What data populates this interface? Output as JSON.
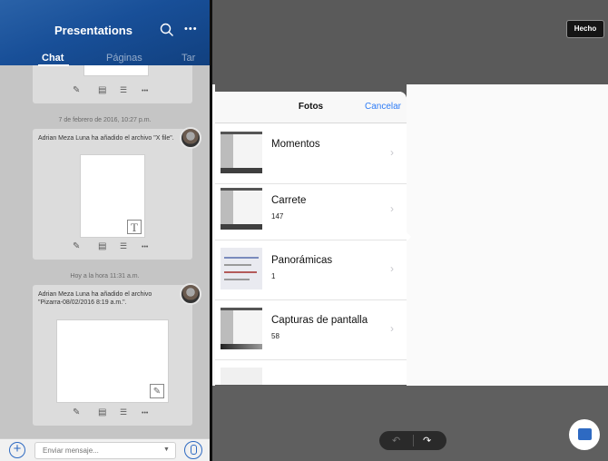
{
  "header": {
    "title": "Presentations",
    "more": "•••",
    "tabs": [
      {
        "label": "Chat",
        "active": true
      },
      {
        "label": "Páginas",
        "active": false
      },
      {
        "label": "Tar",
        "active": false
      }
    ]
  },
  "chat": {
    "messages": [
      {
        "timestamp": "7 de febrero de 2016, 10:27 p.m.",
        "text": "Adrian Meza Luna ha añadido el archivo \"X file\".",
        "thumb_glyph": "T"
      },
      {
        "timestamp": "Hoy a la hora 11:31 a.m.",
        "text": "Adrian Meza Luna ha añadido el archivo \"Pizarra-08/02/2016 8:19 a.m.\".",
        "thumb_glyph": "✎"
      }
    ],
    "actions": [
      "✎",
      "▤",
      "☰",
      "•••"
    ]
  },
  "composer": {
    "placeholder": "Enviar mensaje...",
    "plus": "+",
    "caret": "▼"
  },
  "toolbar": {
    "done_label": "Hecho",
    "undo": "↶",
    "redo": "↷"
  },
  "photos_popover": {
    "title": "Fotos",
    "cancel_label": "Cancelar",
    "albums": [
      {
        "name": "Momentos",
        "count": ""
      },
      {
        "name": "Carrete",
        "count": "147"
      },
      {
        "name": "Panorámicas",
        "count": "1"
      },
      {
        "name": "Capturas de pantalla",
        "count": "58"
      }
    ],
    "chevron": "›"
  },
  "colors": {
    "accent": "#2e6ac2",
    "ios_blue": "#2e7cf6",
    "header_blue": "#184f98"
  }
}
